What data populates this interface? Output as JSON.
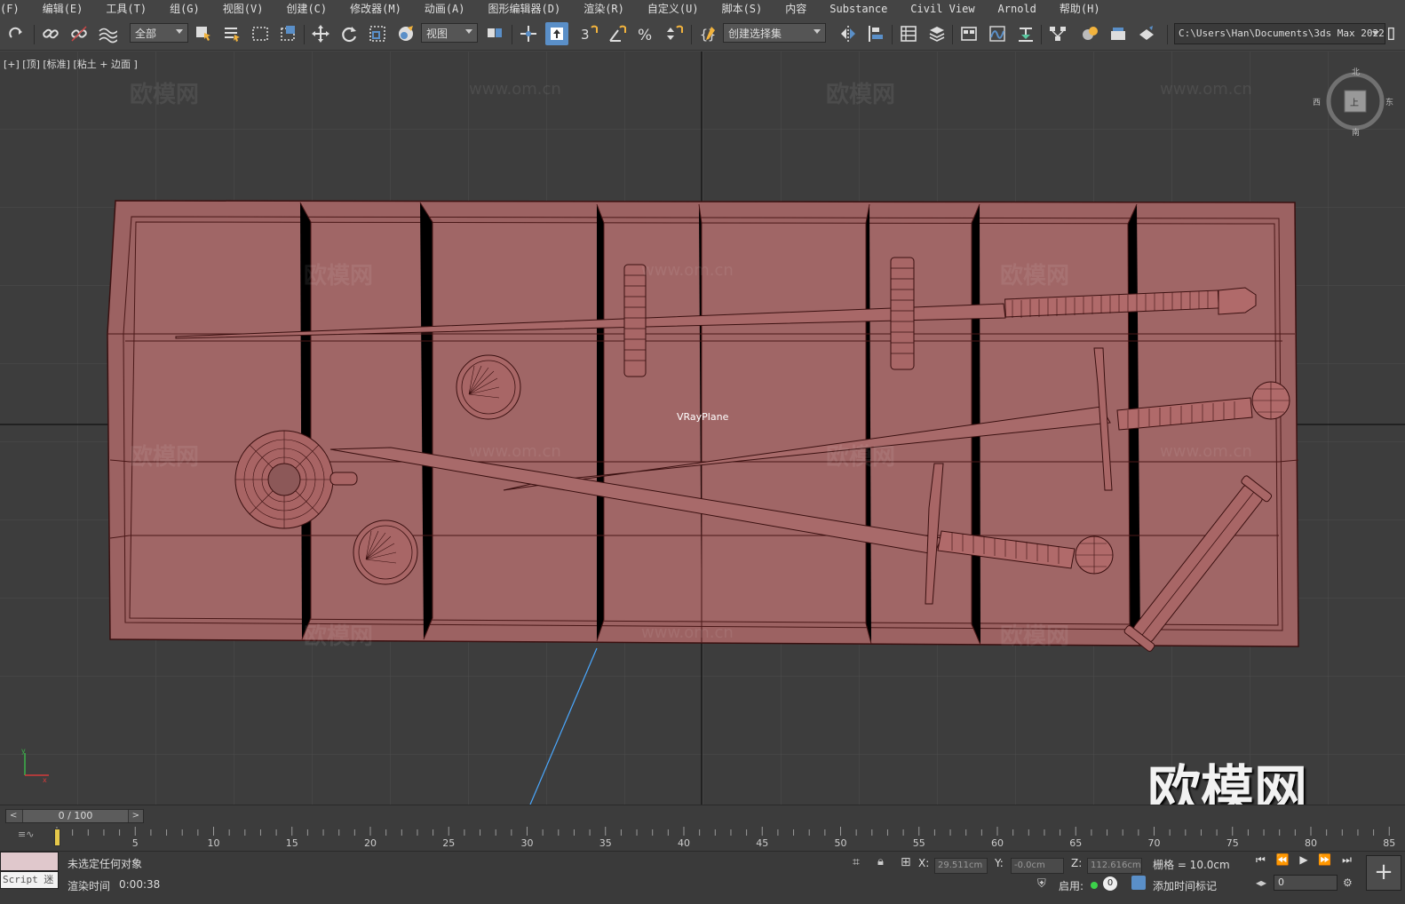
{
  "menu": {
    "items": [
      "(F)",
      "编辑(E)",
      "工具(T)",
      "组(G)",
      "视图(V)",
      "创建(C)",
      "修改器(M)",
      "动画(A)",
      "图形编辑器(D)",
      "渲染(R)",
      "自定义(U)",
      "脚本(S)",
      "内容",
      "Substance",
      "Civil View",
      "Arnold",
      "帮助(H)"
    ]
  },
  "toolbar": {
    "selection_filter": "全部",
    "ref_coord": "视图",
    "named_selection": "创建选择集",
    "project_path": "C:\\Users\\Han\\Documents\\3ds Max 2022",
    "icons": [
      "redo-icon",
      "link-icon",
      "unlink-icon",
      "bind-spacewarp-icon",
      "select-object-icon",
      "select-by-name-icon",
      "rect-region-icon",
      "window-crossing-icon",
      "move-icon",
      "rotate-icon",
      "scale-icon",
      "placement-icon",
      "pivot-icon",
      "snap-3d-icon",
      "angle-snap-icon",
      "percent-snap-icon",
      "spinner-snap-icon",
      "edit-named-sets-icon",
      "mirror-icon",
      "align-icon",
      "scene-explorer-icon",
      "layer-explorer-icon",
      "toggle-ribbon-icon",
      "curve-editor-icon",
      "schematic-icon",
      "material-editor-icon",
      "render-setup-icon",
      "render-frame-icon",
      "render-icon"
    ]
  },
  "viewport": {
    "label": "[+] [顶] [标准] [粘土 + 边面 ]",
    "object_label": "VRayPlane",
    "viewcube_labels": {
      "north": "北",
      "south": "南",
      "west": "西",
      "east": "东",
      "face": "上"
    },
    "watermark_text": "欧模网",
    "watermark_url": "www.om.cn"
  },
  "timeline": {
    "frame_display": "0 / 100",
    "ticks": [
      "5",
      "10",
      "15",
      "20",
      "25",
      "30",
      "35",
      "40",
      "45",
      "50",
      "55",
      "60",
      "65",
      "70",
      "75",
      "80",
      "85"
    ]
  },
  "status": {
    "script_label": "Script 迷",
    "selection_message": "未选定任何对象",
    "render_time_label": "渲染时间",
    "render_time_value": "0:00:38",
    "x_label": "X:",
    "x_value": "29.511cm",
    "y_label": "Y:",
    "y_value": "-0.0cm",
    "z_label": "Z:",
    "z_value": "112.616cm",
    "grid_label": "栅格 = 10.0cm",
    "enable_label": "启用:",
    "key_value": "0",
    "add_time_tag": "添加时间标记",
    "current_frame": "0"
  },
  "colors": {
    "viewport_bg": "#3d3d3d",
    "grid": "#4a4a4a",
    "clay": "#9c6262",
    "wire": "#4a1818",
    "accent": "#5a8fc8"
  }
}
